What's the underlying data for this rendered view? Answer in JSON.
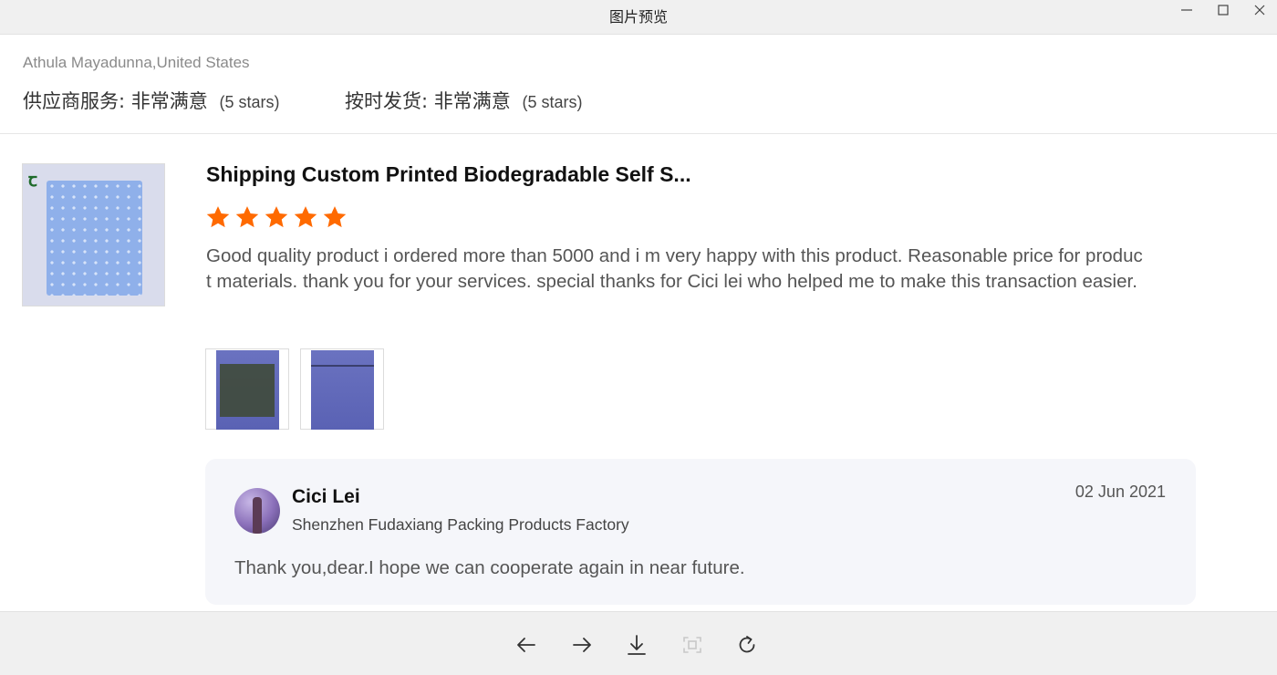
{
  "window": {
    "title": "图片预览",
    "controls": {
      "minimize": "—",
      "maximize": "☐",
      "close": "✕"
    }
  },
  "review": {
    "reviewer": "Athula Mayadunna,United States",
    "ratings": [
      {
        "label": "供应商服务:",
        "value": "非常满意",
        "stars_text": "(5 stars)"
      },
      {
        "label": "按时发货:",
        "value": "非常满意",
        "stars_text": "(5 stars)"
      }
    ],
    "product_title": "Shipping Custom Printed Biodegradable Self S...",
    "star_rating": 5,
    "star_color": "#ff6a00",
    "text": "Good quality product i ordered more than 5000 and i m very happy with this product. Reasonable price for product materials. thank you for your services. special thanks for Cici lei  who helped me to make this transaction easier.",
    "photo_count": 2
  },
  "reply": {
    "name": "Cici Lei",
    "company": "Shenzhen Fudaxiang Packing Products Factory",
    "date": "02 Jun 2021",
    "text": "Thank you,dear.I hope we can cooperate again in near future."
  },
  "toolbar": {
    "icons": [
      "arrow-left-icon",
      "arrow-right-icon",
      "download-icon",
      "fit-screen-icon",
      "rotate-icon"
    ],
    "fit_disabled": true
  }
}
